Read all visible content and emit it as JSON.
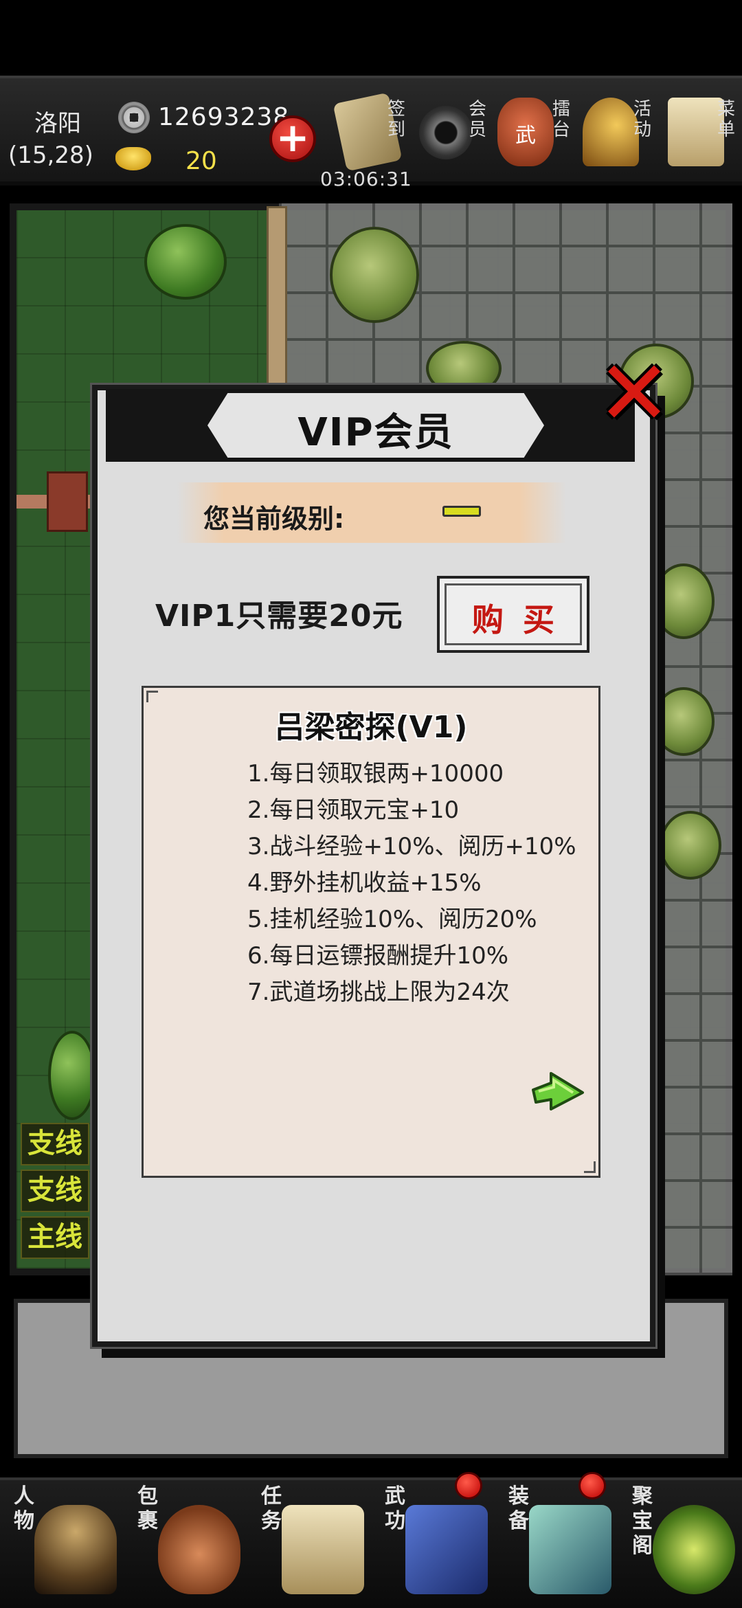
{
  "location": {
    "name": "洛阳",
    "coords": "(15,28)"
  },
  "currency": {
    "silver": "12693238",
    "gold": "20"
  },
  "top_menu": {
    "recharge_icon": "plus-icon",
    "items": [
      {
        "label": "签到",
        "icon": "sign-in-scroll-icon"
      },
      {
        "label": "会员",
        "icon": "vip-ring-icon"
      },
      {
        "label": "擂台",
        "icon": "arena-drum-icon"
      },
      {
        "label": "活动",
        "icon": "event-fan-icon"
      },
      {
        "label": "菜单",
        "icon": "menu-scroll-icon"
      }
    ],
    "timer": "03:06:31"
  },
  "quest_tabs": [
    "支线",
    "支线",
    "主线"
  ],
  "bottom_menu": [
    {
      "label": "人物",
      "icon": "character-icon",
      "badge": false
    },
    {
      "label": "包裹",
      "icon": "bag-icon",
      "badge": false
    },
    {
      "label": "任务",
      "icon": "task-scroll-icon",
      "badge": false
    },
    {
      "label": "武功",
      "icon": "skill-book-icon",
      "badge": true
    },
    {
      "label": "装备",
      "icon": "equipment-icon",
      "badge": true
    },
    {
      "label": "聚宝阁",
      "icon": "treasure-icon",
      "badge": false
    }
  ],
  "vip_dialog": {
    "title": "VIP会员",
    "close_icon": "close-x-icon",
    "level_label": "您当前级别:",
    "offer_text": "VIP1只需要20元",
    "buy_label": "购买",
    "perk_title": "吕梁密探(V1)",
    "perks": [
      "1.每日领取银两+10000",
      "2.每日领取元宝+10",
      "3.战斗经验+10%、阅历+10%",
      "4.野外挂机收益+15%",
      "5.挂机经验10%、阅历20%",
      "6.每日运镖报酬提升10%",
      "7.武道场挑战上限为24次"
    ],
    "next_icon": "next-arrow-icon"
  },
  "colors": {
    "accent_red": "#c41812",
    "gold_text": "#f4e04a",
    "quest_text": "#d8e43a"
  }
}
